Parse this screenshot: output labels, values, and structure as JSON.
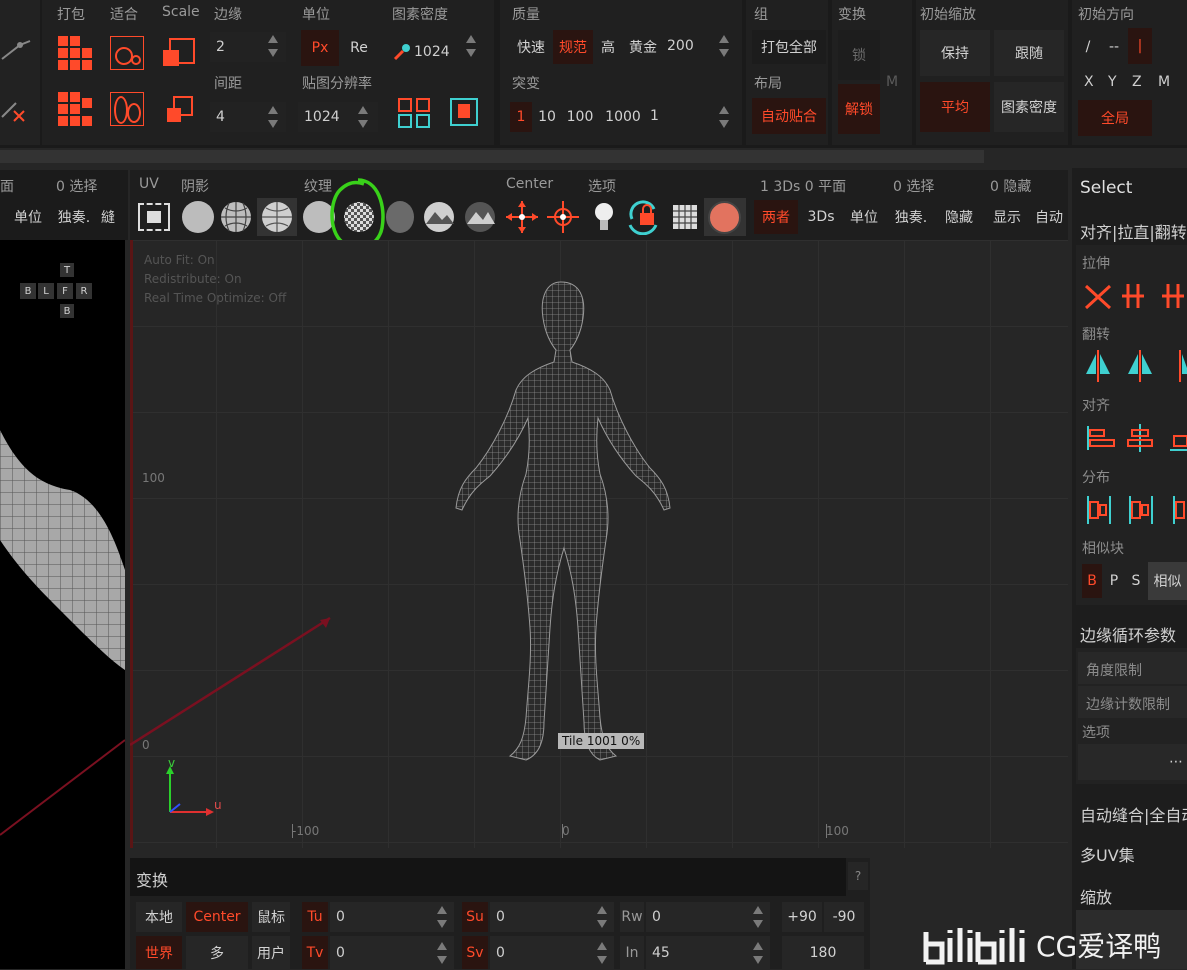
{
  "top_left": {
    "labels": {
      "pack": "打包",
      "fit": "适合",
      "scale": "Scale",
      "edge": "边缘",
      "unit": "单位",
      "density": "图素密度",
      "spacing": "间距",
      "tex_res": "贴图分辨率"
    },
    "edge_value": "2",
    "spacing_value": "4",
    "unit_px": "Px",
    "unit_re": "Re",
    "density_value": "1024",
    "tex_res_value": "1024"
  },
  "top_mid": {
    "quality_label": "质量",
    "quick": "快速",
    "normal": "规范",
    "high": "高",
    "gold": "黄金",
    "gold_value": "200",
    "mutate_label": "突变",
    "mutate_1": "1",
    "mutate_10": "10",
    "mutate_100": "100",
    "mutate_1000": "1000",
    "mutate_val": "1",
    "group_label": "组",
    "pack_all": "打包全部",
    "layout_label": "布局",
    "auto_stitch": "自动贴合",
    "transform_label": "变换",
    "lock": "锁",
    "unlock": "解锁",
    "m": "M"
  },
  "top_right": {
    "init_scale_label": "初始缩放",
    "keep": "保持",
    "follow": "跟随",
    "average": "平均",
    "texel_density": "图素密度",
    "init_dir_label": "初始方向",
    "dir_slash": "/",
    "dir_dash": "--",
    "dir_bar": "|",
    "x": "X",
    "y": "Y",
    "z": "Z",
    "m": "M",
    "global": "全局"
  },
  "left_view": {
    "header_a": "面",
    "header_b": "0 选择",
    "unit": "单位",
    "solo": "独奏.",
    "solo2": "縫",
    "cube": {
      "t": "T",
      "b": "B",
      "l": "L",
      "f": "F",
      "r": "R",
      "bottom": "B"
    }
  },
  "uv_toolbar": {
    "uv": "UV",
    "shade": "阴影",
    "texture": "纹理",
    "center": "Center",
    "options": "选项",
    "stats": "1 3Ds 0 平面",
    "selected": "0 选择",
    "hidden": "0 隐藏",
    "both": "两者",
    "3ds": "3Ds",
    "unit": "单位",
    "solo": "独奏.",
    "hide": "隐藏",
    "show": "显示",
    "auto": "自动"
  },
  "uv_view": {
    "info1": "Auto Fit: On",
    "info2": "Redistribute: On",
    "info3": "Real Time Optimize: Off",
    "y100": "100",
    "y0": "0",
    "xm100": "-100",
    "x0": "0",
    "x100": "100",
    "tile": "Tile 1001 0%",
    "axis_v": "v",
    "axis_u": "u"
  },
  "right_panel": {
    "select": "Select",
    "align_flip": "对齐|拉直|翻转",
    "stretch": "拉伸",
    "flip": "翻转",
    "align": "对齐",
    "distribute": "分布",
    "similar": "相似块",
    "b": "B",
    "p": "P",
    "s": "S",
    "similar_btn": "相似",
    "edge_loop": "边缘循环参数",
    "angle_limit": "角度限制",
    "edge_count": "边缘计数限制",
    "options": "选项",
    "dots": "⋯",
    "auto_stitch": "自动缝合|全自动",
    "multi_uv": "多UV集",
    "zoom": "缩放"
  },
  "transform_panel": {
    "title": "变换",
    "help": "?",
    "local": "本地",
    "center": "Center",
    "mouse": "鼠标",
    "world": "世界",
    "multi": "多",
    "user": "用户",
    "tu": "Tu",
    "tu_val": "0",
    "su": "Su",
    "su_val": "0",
    "rw": "Rw",
    "rw_val": "0",
    "p90": "+90",
    "m90": "-90",
    "tv": "Tv",
    "tv_val": "0",
    "sv": "Sv",
    "sv_val": "0",
    "in": "In",
    "in_val": "45",
    "r180": "180"
  },
  "watermark": "CG爱译鸭",
  "colors": {
    "accent": "#ff4a2a",
    "panel": "#1f1f1f",
    "highlight_circle": "#39d11a"
  }
}
